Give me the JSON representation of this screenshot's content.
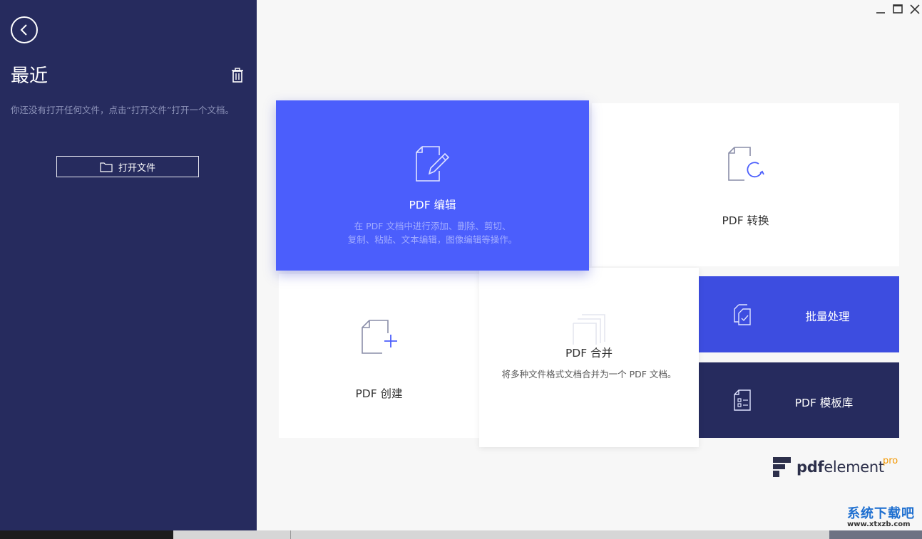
{
  "sidebar": {
    "title": "最近",
    "empty_message": "你还没有打开任何文件，点击“打开文件”打开一个文档。",
    "open_button_label": "打开文件"
  },
  "cards": {
    "edit": {
      "title": "PDF 编辑",
      "description_line1": "在 PDF 文档中进行添加、删除、剪切、",
      "description_line2": "复制、粘贴、文本编辑，图像编辑等操作。"
    },
    "convert": {
      "title": "PDF 转换"
    },
    "create": {
      "title": "PDF 创建"
    },
    "merge": {
      "title": "PDF 合并",
      "description": "将多种文件格式文档合并为一个 PDF 文档。"
    },
    "batch": {
      "title": "批量处理"
    },
    "template": {
      "title": "PDF 模板库"
    }
  },
  "brand": {
    "name_bold": "pdf",
    "name_rest": "element",
    "edition": "pro"
  },
  "watermark": {
    "name": "系统下载吧",
    "url": "www.xtxzb.com"
  },
  "colors": {
    "sidebar": "#262b5e",
    "accent": "#4b5efc",
    "batch": "#3d4de0",
    "icon_stroke": "#8a8ea8",
    "accent_icon": "#4b5efc",
    "pro": "#f39800"
  }
}
